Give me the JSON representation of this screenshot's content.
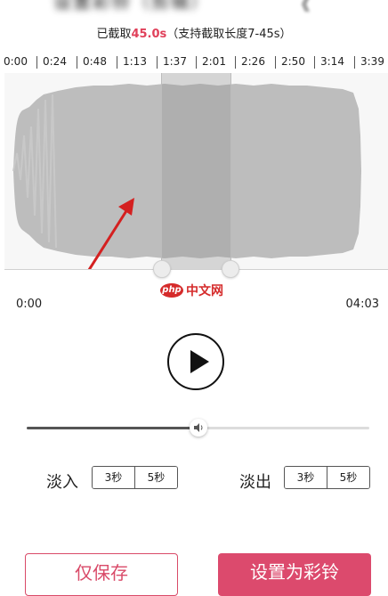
{
  "header": {
    "blurred_title": "设置彩铃（剪辑）",
    "blurred_right": "《"
  },
  "cut_info": {
    "prefix": "已截取",
    "value": "45.0s",
    "suffix": "（支持截取长度7-45s）"
  },
  "timeline": {
    "ticks": [
      "0:00",
      "0:24",
      "0:48",
      "1:13",
      "1:37",
      "2:01",
      "2:26",
      "2:50",
      "3:14",
      "3:39"
    ]
  },
  "waveform": {
    "start_time": "0:00",
    "end_time": "04:03"
  },
  "watermark": {
    "logo": "php",
    "text": "中文网"
  },
  "player": {
    "play_icon": "play-icon",
    "volume_level": 0.5,
    "volume_icon": "speaker-icon"
  },
  "fade_in": {
    "label": "淡入",
    "options": [
      "3秒",
      "5秒"
    ]
  },
  "fade_out": {
    "label": "淡出",
    "options": [
      "3秒",
      "5秒"
    ]
  },
  "actions": {
    "save_only": "仅保存",
    "set_ringtone": "设置为彩铃"
  },
  "colors": {
    "accent": "#dc4a6d",
    "highlight": "#e0405a",
    "arrow": "#d42020"
  }
}
